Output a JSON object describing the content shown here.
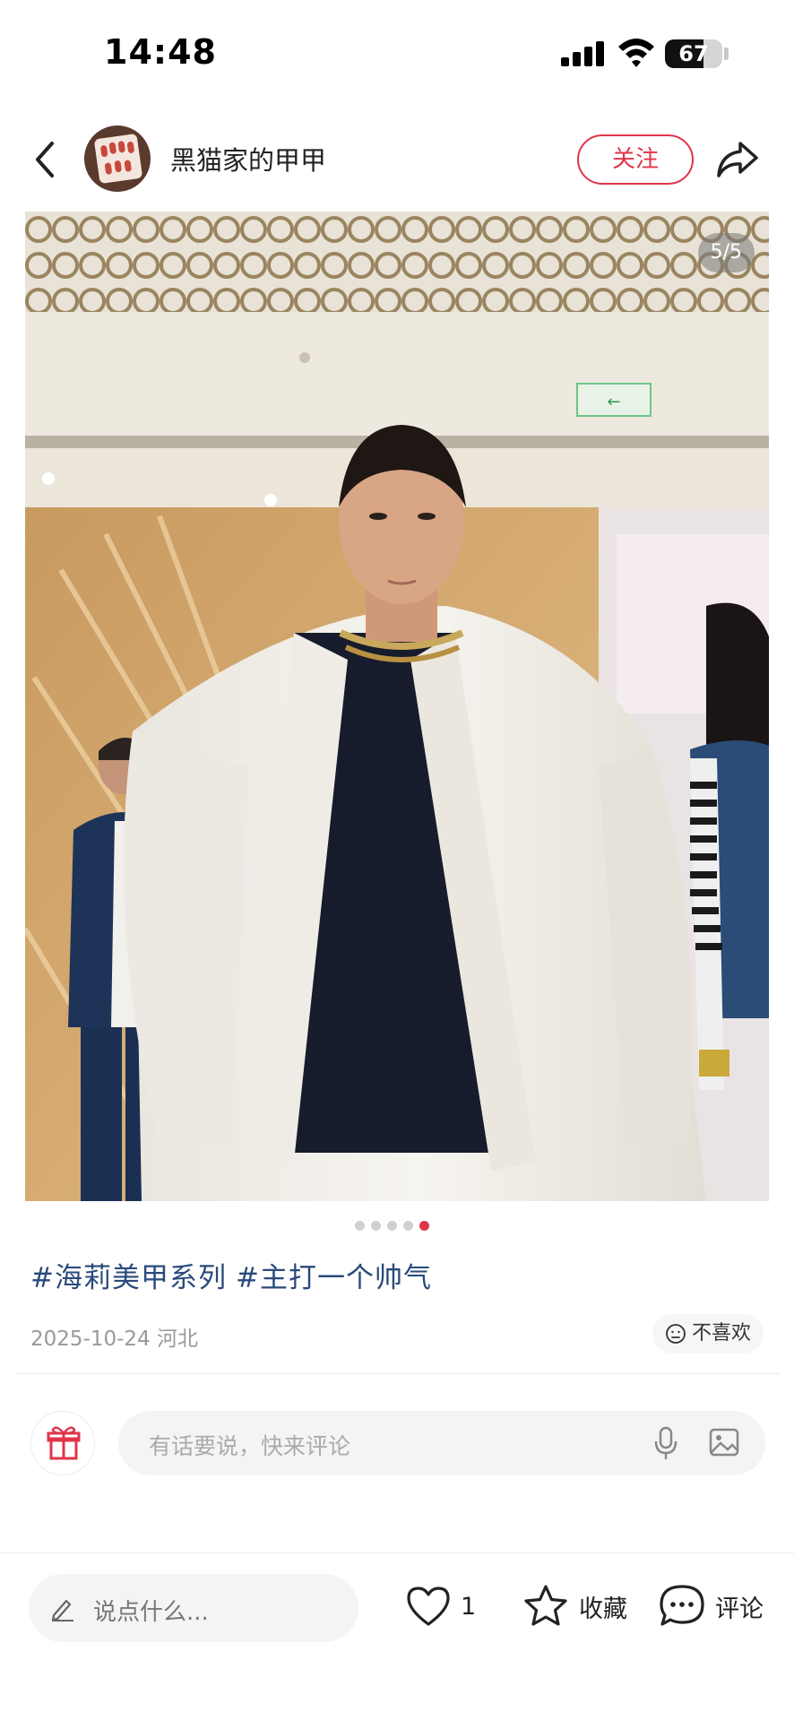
{
  "status_bar": {
    "time": "14:48",
    "battery": "67",
    "battery_level": 0.67
  },
  "header": {
    "author_name": "黑猫家的甲甲",
    "follow_label": "关注"
  },
  "gallery": {
    "page_indicator": "5/5",
    "total_pages": 5,
    "current_page": 5
  },
  "post": {
    "tags": [
      "#海莉美甲系列",
      "#主打一个帅气"
    ],
    "date_location": "2025-10-24 河北",
    "dislike_label": "不喜欢"
  },
  "comment_box": {
    "placeholder": "有话要说，快来评论"
  },
  "bottom_bar": {
    "say_placeholder": "说点什么...",
    "like_count": "1",
    "favorite_label": "收藏",
    "comment_label": "评论"
  },
  "colors": {
    "accent": "#e0344a",
    "tag": "#2a4a7a"
  },
  "icons": [
    "back-arrow-icon",
    "share-icon",
    "gift-icon",
    "mic-icon",
    "image-icon",
    "pencil-icon",
    "heart-icon",
    "star-icon",
    "comment-bubble-icon",
    "sad-face-icon"
  ]
}
